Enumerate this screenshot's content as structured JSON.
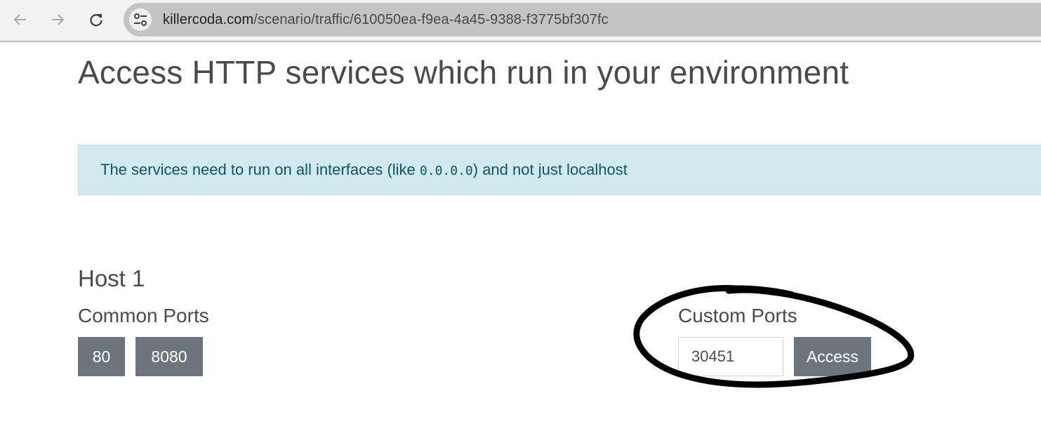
{
  "browser": {
    "back_icon": "arrow-left-icon",
    "forward_icon": "arrow-right-icon",
    "reload_icon": "reload-icon",
    "site_info_icon": "tune-icon",
    "url_host": "killercoda.com",
    "url_path": "/scenario/traffic/610050ea-f9ea-4a45-9388-f3775bf307fc"
  },
  "page": {
    "title": "Access HTTP services which run in your environment",
    "alert": {
      "text_before": "The services need to run on all interfaces (like ",
      "code": "0.0.0.0",
      "text_after": ") and not just localhost",
      "background": "#d1eaef",
      "text_color": "#135360"
    },
    "host": {
      "heading": "Host 1",
      "common_ports_label": "Common Ports",
      "common_ports": [
        "80",
        "8080"
      ],
      "custom_ports_label": "Custom Ports",
      "custom_port_value": "30451",
      "access_label": "Access",
      "button_color": "#6c757d"
    },
    "annotation": {
      "type": "hand-drawn circle around custom ports",
      "color": "#000000"
    }
  }
}
